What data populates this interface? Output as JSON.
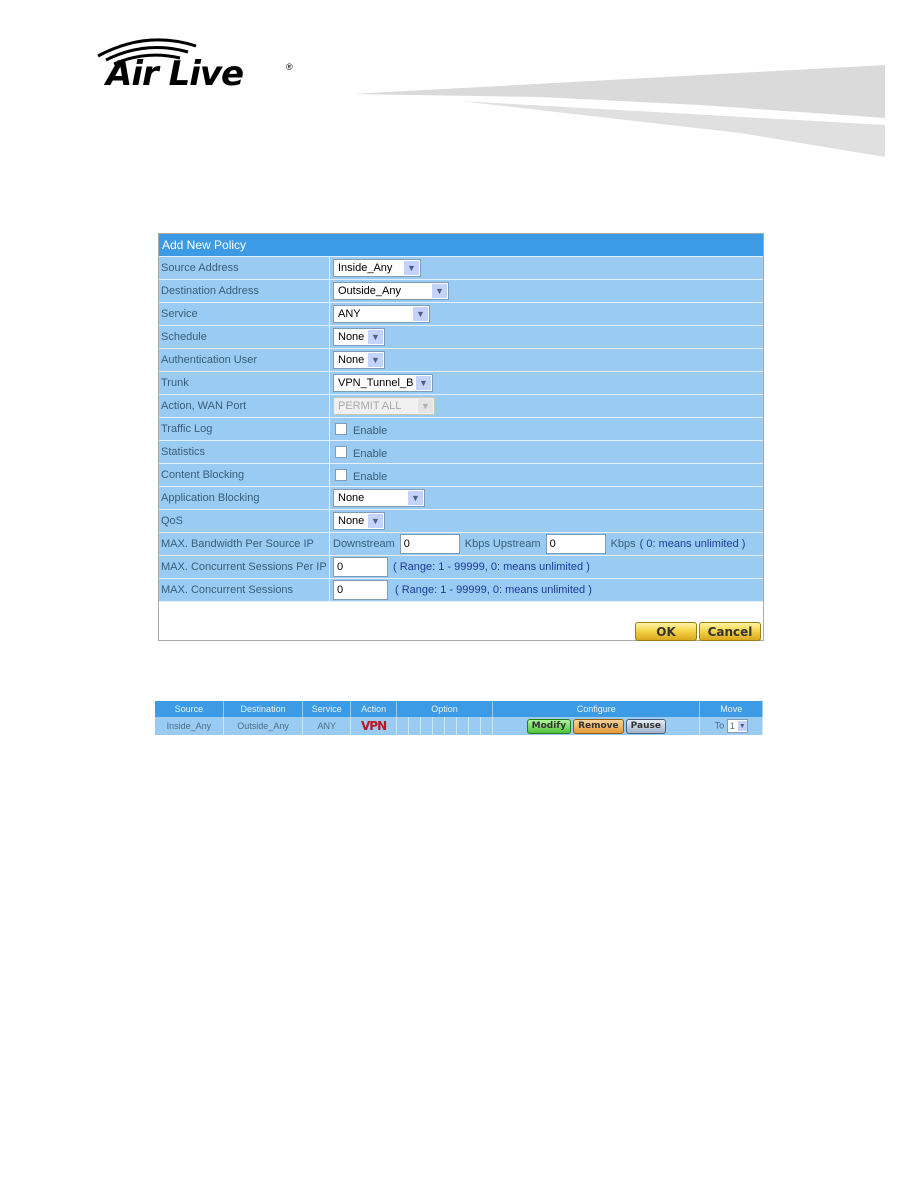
{
  "brand": {
    "name": "Air Live",
    "registered": "®"
  },
  "policy_form": {
    "title": "Add New Policy",
    "rows": {
      "source_address": {
        "label": "Source Address",
        "value": "Inside_Any"
      },
      "destination_address": {
        "label": "Destination Address",
        "value": "Outside_Any"
      },
      "service": {
        "label": "Service",
        "value": "ANY"
      },
      "schedule": {
        "label": "Schedule",
        "value": "None"
      },
      "auth_user": {
        "label": "Authentication User",
        "value": "None"
      },
      "trunk": {
        "label": "Trunk",
        "value": "VPN_Tunnel_B"
      },
      "action_wan": {
        "label": "Action, WAN Port",
        "value": "PERMIT ALL"
      },
      "traffic_log": {
        "label": "Traffic Log",
        "checkbox_label": "Enable",
        "checked": false
      },
      "statistics": {
        "label": "Statistics",
        "checkbox_label": "Enable",
        "checked": false
      },
      "content_blocking": {
        "label": "Content Blocking",
        "checkbox_label": "Enable",
        "checked": false
      },
      "app_blocking": {
        "label": "Application Blocking",
        "value": "None"
      },
      "qos": {
        "label": "QoS",
        "value": "None"
      },
      "bandwidth": {
        "label": "MAX. Bandwidth Per Source IP",
        "downstream_label": "Downstream",
        "downstream": "0",
        "upstream_label": "Kbps Upstream",
        "upstream": "0",
        "unit": "Kbps",
        "note": "( 0: means unlimited )"
      },
      "sessions_per_ip": {
        "label": "MAX. Concurrent Sessions Per IP",
        "value": "0",
        "note": "( Range: 1 - 99999, 0: means unlimited )"
      },
      "sessions": {
        "label": "MAX. Concurrent Sessions",
        "value": "0",
        "note": "( Range: 1 - 99999, 0: means unlimited )"
      }
    },
    "ok_label": "OK",
    "cancel_label": "Cancel"
  },
  "policy_list": {
    "headers": [
      "Source",
      "Destination",
      "Service",
      "Action",
      "Option",
      "Configure",
      "Move"
    ],
    "rows": [
      {
        "source": "Inside_Any",
        "destination": "Outside_Any",
        "service": "ANY",
        "action": "VPN",
        "modify": "Modify",
        "remove": "Remove",
        "pause": "Pause",
        "move_to": "To",
        "move_value": "1"
      }
    ]
  }
}
